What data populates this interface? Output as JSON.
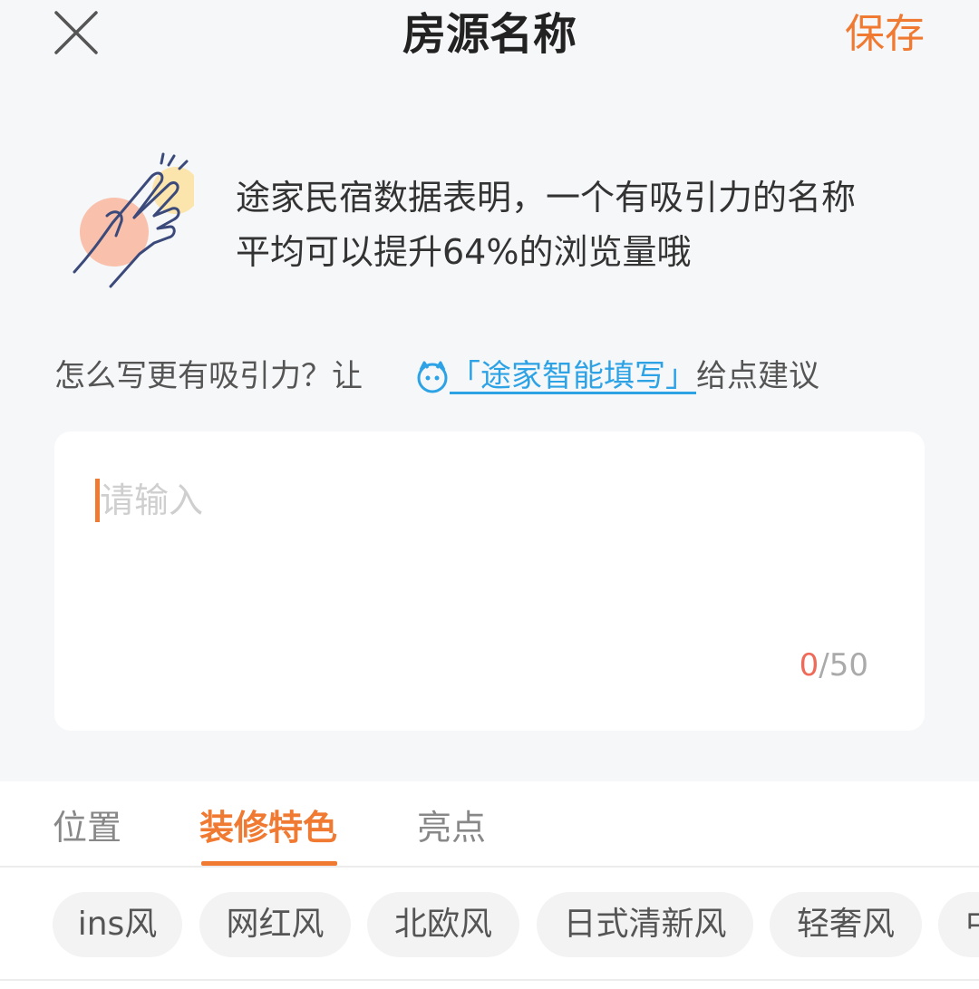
{
  "header": {
    "title": "房源名称",
    "save_label": "保存"
  },
  "tip": {
    "line1": "途家民宿数据表明，一个有吸引力的名称",
    "line2": "平均可以提升64%的浏览量哦"
  },
  "hint": {
    "prefix": "怎么写更有吸引力？让",
    "link": "「途家智能填写」",
    "suffix": "给点建议"
  },
  "input": {
    "placeholder": "请输入",
    "count_current": "0",
    "count_sep_max": "/50"
  },
  "tabs": [
    {
      "label": "位置"
    },
    {
      "label": "装修特色"
    },
    {
      "label": "亮点"
    }
  ],
  "active_tab": "装修特色",
  "chips": [
    {
      "label": "ins风"
    },
    {
      "label": "网红风"
    },
    {
      "label": "北欧风"
    },
    {
      "label": "日式清新风"
    },
    {
      "label": "轻奢风"
    },
    {
      "label": "中"
    }
  ],
  "colors": {
    "accent": "#f07a32",
    "link": "#2da3e6",
    "counter_current": "#f06a5a",
    "background": "#f6f7f9"
  },
  "icons": [
    "close-icon",
    "hand-snap-illustration",
    "robot-assistant-icon"
  ]
}
